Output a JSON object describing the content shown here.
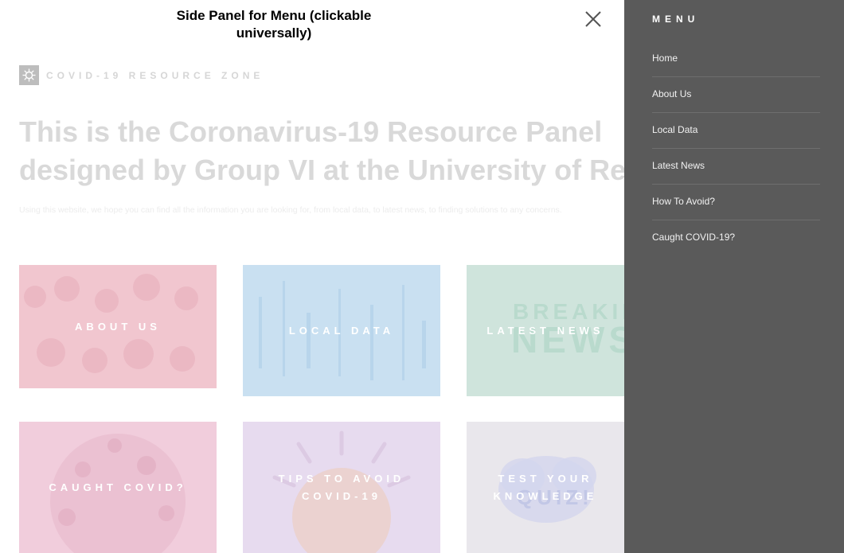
{
  "annotation": {
    "line1": "Side Panel for Menu (clickable",
    "line2": "universally)"
  },
  "brand": {
    "name": "COVID-19 RESOURCE ZONE",
    "icon": "virus-icon"
  },
  "headline": {
    "line1": "This is the Coronavirus-19 Resource Panel",
    "line2": "designed by Group VI at the University of Reading."
  },
  "subtext": "Using this website, we hope you can find all the information you are looking for, from local data, to latest news, to finding solutions to any concerns.",
  "tiles": [
    {
      "label": "ABOUT US",
      "color": "#f1c6cf"
    },
    {
      "label": "LOCAL DATA",
      "color": "#c9e0f1"
    },
    {
      "label": "LATEST NEWS",
      "art_text1": "BREAKING",
      "art_text2": "NEWS",
      "color": "#cfe4dc"
    },
    {
      "label": "CAUGHT COVID?",
      "color": "#f1cddc"
    },
    {
      "label1": "TIPS TO AVOID",
      "label2": "COVID-19",
      "color": "#e7dbef"
    },
    {
      "label1": "TEST YOUR",
      "label2": "KNOWLEDGE",
      "art_text": "QUIZ!",
      "color": "#e9e7ec"
    }
  ],
  "close_icon": "close-icon",
  "menu": {
    "title": "MENU",
    "items": [
      {
        "label": "Home"
      },
      {
        "label": "About Us"
      },
      {
        "label": "Local Data"
      },
      {
        "label": "Latest News"
      },
      {
        "label": "How To Avoid?"
      },
      {
        "label": "Caught COVID-19?"
      }
    ]
  },
  "colors": {
    "panel_bg": "#5a5a5a",
    "headline_faded": "#d9d9d9"
  }
}
